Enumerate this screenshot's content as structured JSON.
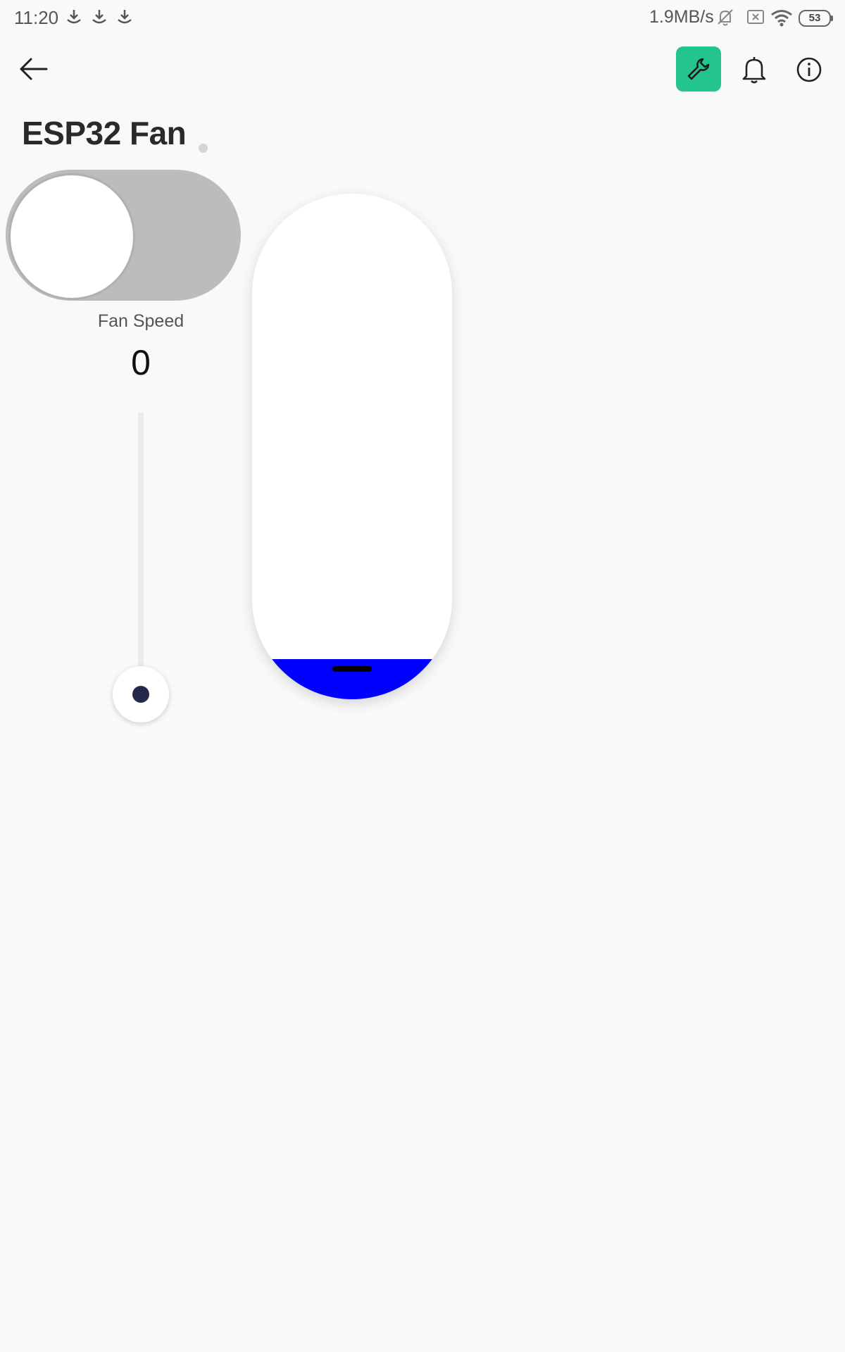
{
  "status_bar": {
    "time": "11:20",
    "net_speed": "1.9MB/s",
    "battery": "53"
  },
  "app_bar": {
    "back_icon": "arrow-left-icon",
    "settings_icon": "wrench-icon",
    "notifications_icon": "bell-icon",
    "info_icon": "info-icon",
    "accent_color": "#23c48e"
  },
  "device": {
    "title": "ESP32 Fan"
  },
  "power_switch": {
    "state": "off",
    "track_color": "#bcbcbe"
  },
  "fan_speed": {
    "label": "Fan Speed",
    "value": "0",
    "thumb_color": "#252849"
  },
  "level_control": {
    "fill_fraction": 0.08,
    "fill_color": "#0000ff"
  }
}
